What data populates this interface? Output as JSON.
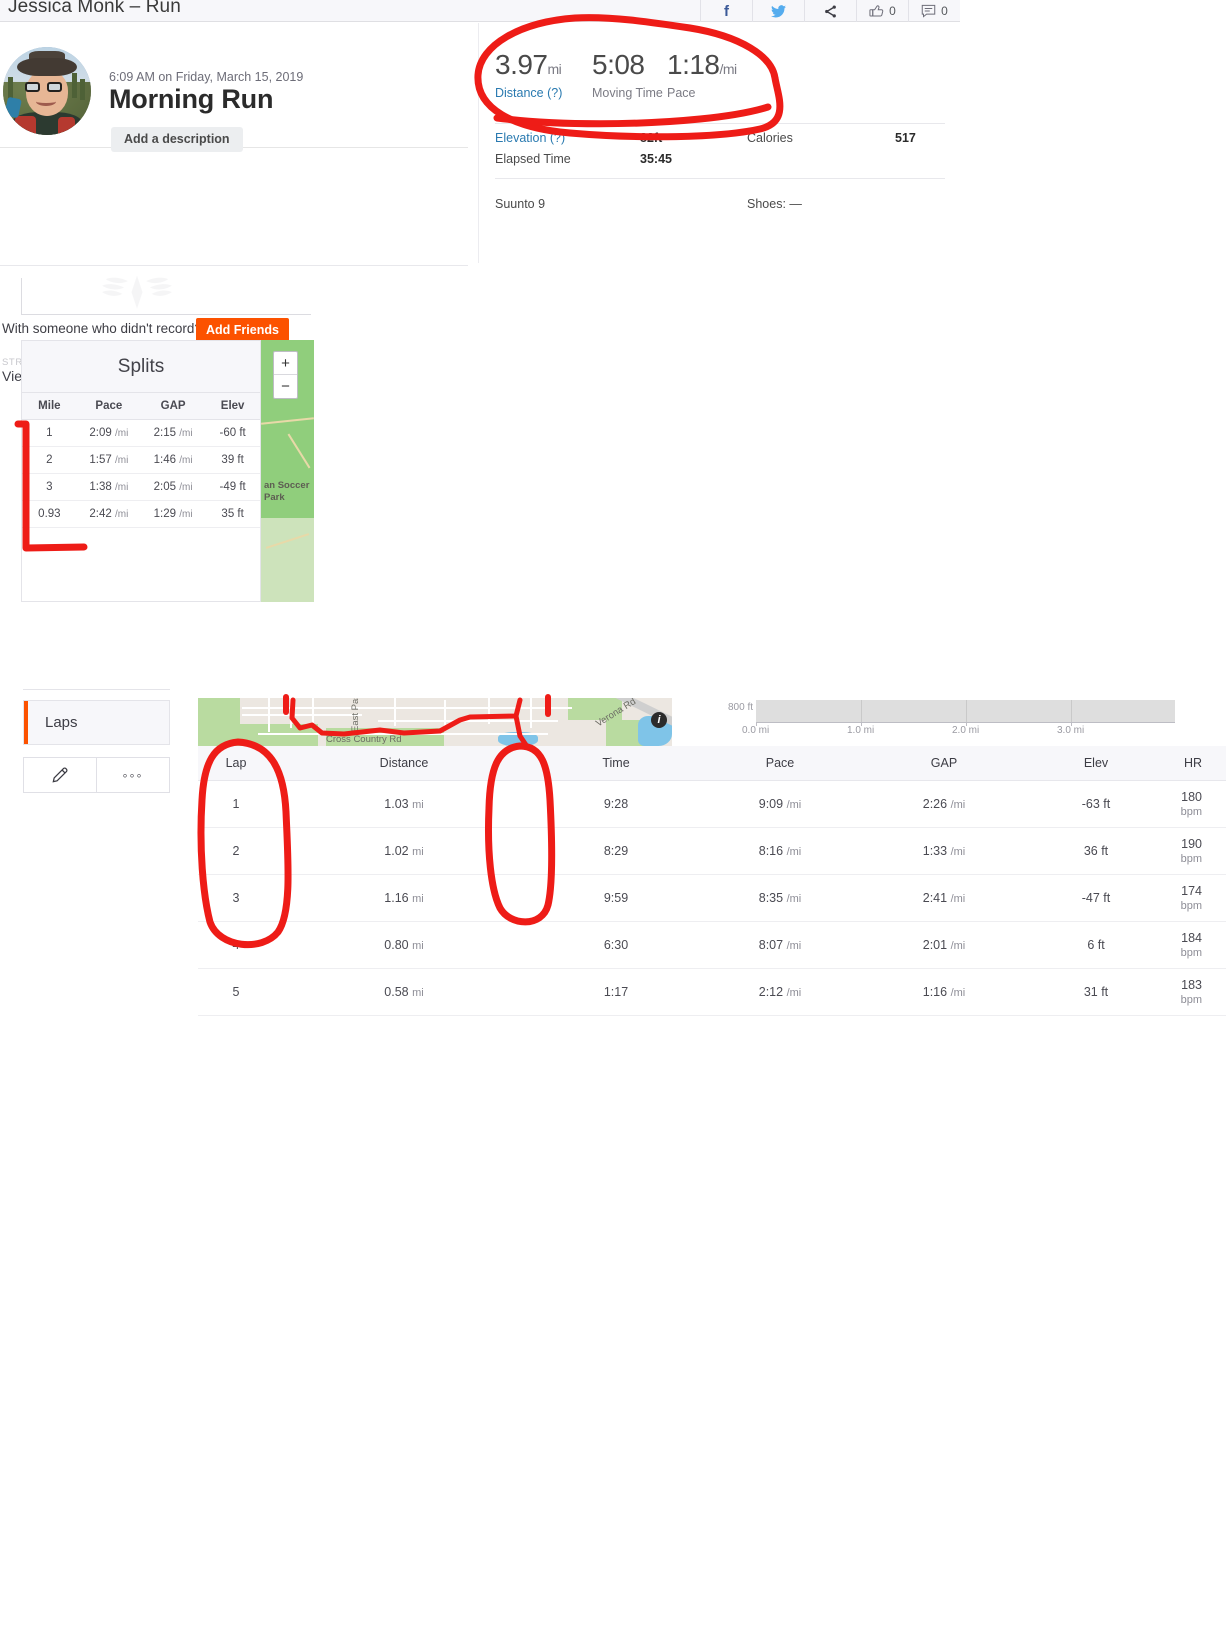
{
  "window": {
    "title": "Jessica Monk – Run"
  },
  "social": {
    "facebook_icon": "facebook-icon",
    "twitter_icon": "twitter-icon",
    "share_icon": "share-icon",
    "kudos_icon": "kudos-icon",
    "kudos_count": "0",
    "comment_icon": "comment-icon",
    "comment_count": "0"
  },
  "activity": {
    "date": "6:09 AM on Friday, March 15, 2019",
    "title": "Morning Run",
    "add_description_label": "Add a description",
    "avatar_name": "avatar"
  },
  "social_prompt": {
    "question": "With someone who didn't record?",
    "add_friends_label": "Add Friends"
  },
  "labs": {
    "eyebrow": "STRAVA LABS",
    "link": "View Flybys",
    "chevron": "›"
  },
  "stats": {
    "primary": [
      {
        "value": "3.97",
        "unit": "mi",
        "label": "Distance (?)",
        "is_link": true
      },
      {
        "value": "5:08",
        "unit": "",
        "label": "Moving Time",
        "is_link": false
      },
      {
        "value": "1:18",
        "unit": "/mi",
        "label": "Pace",
        "is_link": false
      }
    ],
    "rows": [
      {
        "key": "Elevation (?)",
        "value": "82ft",
        "key_link": true,
        "key2": "Calories",
        "value2": "517"
      },
      {
        "key": "Elapsed Time",
        "value": "35:45",
        "key_link": false,
        "key2": "",
        "value2": ""
      }
    ],
    "gear": {
      "device": "Suunto 9",
      "shoes": "Shoes: —"
    }
  },
  "splits": {
    "caption": "Splits",
    "columns": [
      "Mile",
      "Pace",
      "GAP",
      "Elev"
    ],
    "rows": [
      {
        "mile": "1",
        "pace": "2:09",
        "pace_unit": "/mi",
        "gap": "2:15",
        "gap_unit": "/mi",
        "elev": "-60 ft"
      },
      {
        "mile": "2",
        "pace": "1:57",
        "pace_unit": "/mi",
        "gap": "1:46",
        "gap_unit": "/mi",
        "elev": "39 ft"
      },
      {
        "mile": "3",
        "pace": "1:38",
        "pace_unit": "/mi",
        "gap": "2:05",
        "gap_unit": "/mi",
        "elev": "-49 ft"
      },
      {
        "mile": "0.93",
        "pace": "2:42",
        "pace_unit": "/mi",
        "gap": "1:29",
        "gap_unit": "/mi",
        "elev": "35 ft"
      }
    ],
    "map_label": "an Soccer Park",
    "zoom_in": "+",
    "zoom_out": "−"
  },
  "laps_panel": {
    "tab_label": "Laps",
    "edit_icon": "pencil-icon",
    "more_icon": "more-options-icon"
  },
  "map": {
    "labels": [
      "East Pas",
      "Cross Country Rd",
      "Verona Rd"
    ],
    "info_glyph": "i"
  },
  "chart_data": {
    "type": "area",
    "title": "",
    "xlabel": "",
    "ylabel": "",
    "y_tick_labels": [
      "800 ft"
    ],
    "x_tick_labels": [
      "0.0 mi",
      "1.0 mi",
      "2.0 mi",
      "3.0 mi"
    ],
    "x": [
      0.0,
      1.0,
      2.0,
      3.0
    ],
    "xlim": [
      0.0,
      3.97
    ],
    "ylim": [
      800,
      900
    ],
    "grid": true,
    "legend": "none",
    "note": "elevation profile clipped at top of viewport; only baseline band visible"
  },
  "laps": {
    "columns": [
      "Lap",
      "Distance",
      "Time",
      "Pace",
      "GAP",
      "Elev",
      "HR"
    ],
    "rows": [
      {
        "lap": "1",
        "distance": "1.03",
        "distance_unit": "mi",
        "time": "9:28",
        "pace": "9:09",
        "pace_unit": "/mi",
        "gap": "2:26",
        "gap_unit": "/mi",
        "elev": "-63 ft",
        "hr": "180",
        "hr_unit": "bpm"
      },
      {
        "lap": "2",
        "distance": "1.02",
        "distance_unit": "mi",
        "time": "8:29",
        "pace": "8:16",
        "pace_unit": "/mi",
        "gap": "1:33",
        "gap_unit": "/mi",
        "elev": "36 ft",
        "hr": "190",
        "hr_unit": "bpm"
      },
      {
        "lap": "3",
        "distance": "1.16",
        "distance_unit": "mi",
        "time": "9:59",
        "pace": "8:35",
        "pace_unit": "/mi",
        "gap": "2:41",
        "gap_unit": "/mi",
        "elev": "-47 ft",
        "hr": "174",
        "hr_unit": "bpm"
      },
      {
        "lap": "4",
        "distance": "0.80",
        "distance_unit": "mi",
        "time": "6:30",
        "pace": "8:07",
        "pace_unit": "/mi",
        "gap": "2:01",
        "gap_unit": "/mi",
        "elev": "6 ft",
        "hr": "184",
        "hr_unit": "bpm"
      },
      {
        "lap": "5",
        "distance": "0.58",
        "distance_unit": "mi",
        "time": "1:17",
        "pace": "2:12",
        "pace_unit": "/mi",
        "gap": "1:16",
        "gap_unit": "/mi",
        "elev": "31 ft",
        "hr": "183",
        "hr_unit": "bpm"
      }
    ]
  },
  "annotations": {
    "color": "#ee1c17",
    "marks": [
      "ellipse around primary stats",
      "bracket around splits Mile column",
      "ellipse around laps Lap column",
      "ellipse around laps Time column",
      "highlighted GPS route on map"
    ]
  }
}
